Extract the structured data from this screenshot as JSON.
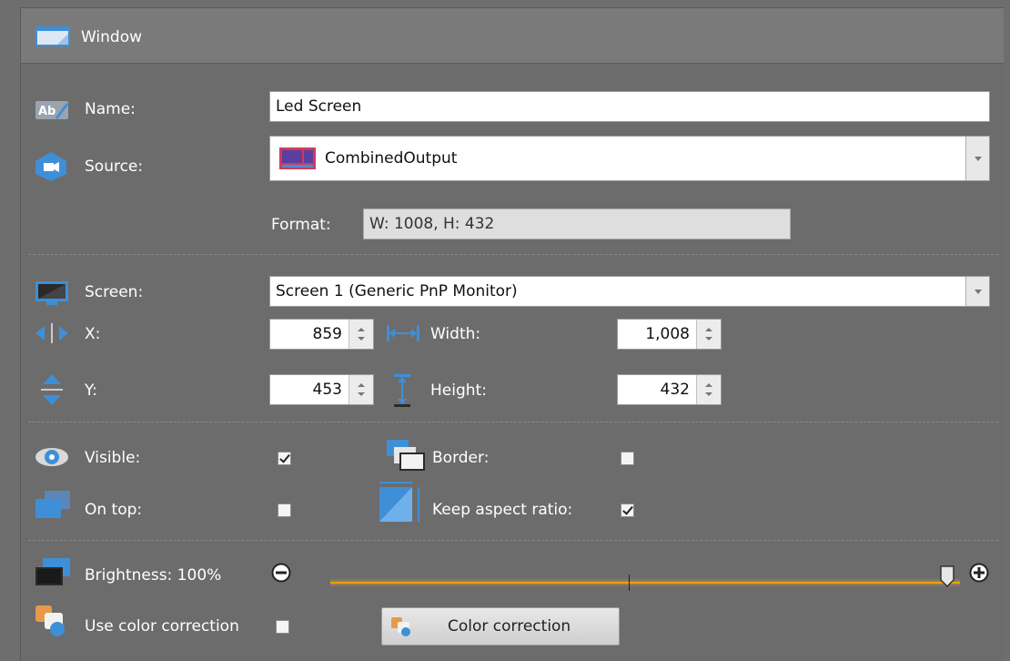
{
  "window": {
    "title": "Window",
    "name_label": "Name:",
    "name_value": "Led Screen",
    "source_label": "Source:",
    "source_value": "CombinedOutput",
    "format_label": "Format:",
    "format_value": "W: 1008, H: 432",
    "screen_label": "Screen:",
    "screen_value": "Screen 1 (Generic PnP Monitor)",
    "x_label": "X:",
    "x_value": "859",
    "y_label": "Y:",
    "y_value": "453",
    "width_label": "Width:",
    "width_value": "1,008",
    "height_label": "Height:",
    "height_value": "432",
    "visible_label": "Visible:",
    "visible_checked": true,
    "border_label": "Border:",
    "border_checked": false,
    "ontop_label": "On top:",
    "ontop_checked": false,
    "keep_aspect_label": "Keep aspect ratio:",
    "keep_aspect_checked": true,
    "brightness_label": "Brightness: 100%",
    "brightness_value": 100,
    "use_cc_label": "Use color correction",
    "use_cc_checked": false,
    "cc_button_label": "Color correction"
  },
  "colors": {
    "panel_bg": "#6c6c6c",
    "title_bg": "#7a7a7a",
    "icon_blue": "#3f8fd8",
    "slider_accent": "#f0a000"
  }
}
